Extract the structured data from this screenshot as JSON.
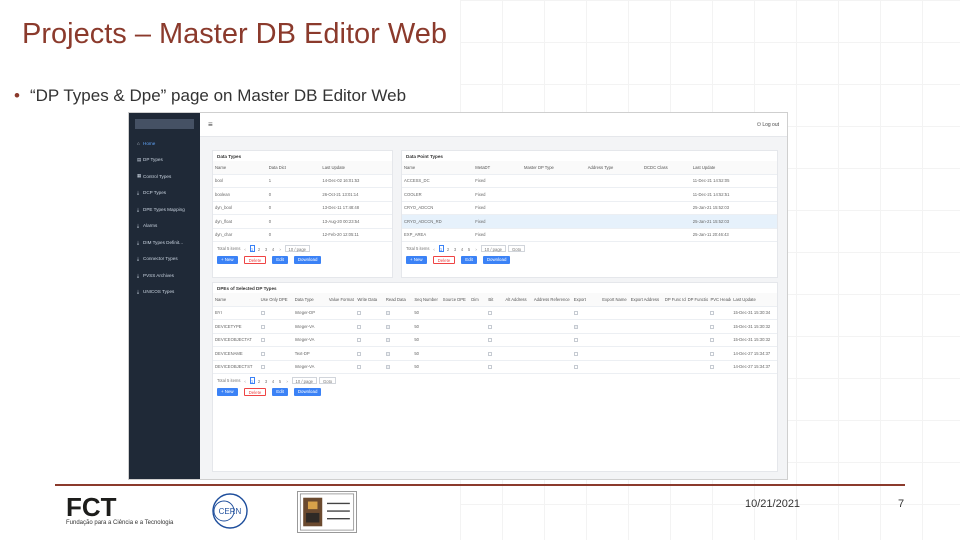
{
  "slide": {
    "title": "Projects – Master DB Editor Web",
    "bullet": "“DP Types & Dpe” page on Master DB Editor Web",
    "date": "10/21/2021",
    "page_number": "7",
    "footer_org": "Fundação para a Ciência e a Tecnologia",
    "accent_color": "#8b3a2c"
  },
  "app": {
    "logout_label": "Log out",
    "sidebar": [
      {
        "label": "Home",
        "icon": "home-icon",
        "active": true
      },
      {
        "label": "DP Types",
        "icon": "list-icon"
      },
      {
        "label": "Control Types",
        "icon": "grid-icon"
      },
      {
        "label": "DCP Types",
        "icon": "download-icon"
      },
      {
        "label": "DPE Types Mapping",
        "icon": "download-icon"
      },
      {
        "label": "Alarms",
        "icon": "download-icon"
      },
      {
        "label": "DIM Types Definit...",
        "icon": "download-icon"
      },
      {
        "label": "Connector Types",
        "icon": "download-icon"
      },
      {
        "label": "PVSS Archives",
        "icon": "download-icon"
      },
      {
        "label": "UNICOS Types",
        "icon": "download-icon"
      }
    ],
    "data_types": {
      "title": "Data Types",
      "headers": [
        "Name",
        "Data Dict",
        "Last Update"
      ],
      "rows": [
        [
          "bool",
          "1",
          "14-Dec-02 16:01:53"
        ],
        [
          "boolean",
          "0",
          "26-Oct-21 13:01:14"
        ],
        [
          "dyn_bool",
          "0",
          "13-Dec-11 17:48:48"
        ],
        [
          "dyn_float",
          "0",
          "13-Aug-20 00:23:54"
        ],
        [
          "dyn_char",
          "0",
          "12-Feb-20 12:05:11"
        ]
      ]
    },
    "data_point_types": {
      "title": "Data Point Types",
      "headers": [
        "Name",
        "MetaDT",
        "Master DP Type",
        "Address Type",
        "DCDC Class",
        "Last Update"
      ],
      "rows": [
        [
          "ACCESS_DC",
          "Fixed",
          "",
          "",
          "",
          "11-Dec-21 14:52:05"
        ],
        [
          "COOLER",
          "Fixed",
          "",
          "",
          "",
          "11-Dec-21 14:52:51"
        ],
        [
          "CRYO_ADCCN",
          "Fixed",
          "",
          "",
          "",
          "25-Jan-21 15:52:03"
        ],
        [
          "CRYO_ADCCN_RD",
          "Fixed",
          "",
          "",
          "",
          "25-Jan-21 15:52:03"
        ],
        [
          "EXP_AREA",
          "Fixed",
          "",
          "",
          "",
          "25-Jan-11 20:46:43"
        ]
      ]
    },
    "dpe_table": {
      "title": "DPEs of Selected DP Types",
      "headers": [
        "Name",
        "Use Only DPE",
        "Data Type",
        "Value Format",
        "Write Data",
        "Read Data",
        "Seq Number",
        "Source DPE",
        "Dim",
        "Bit",
        "Alt Address",
        "Address Reference",
        "Export",
        "Export Name",
        "Export Address",
        "DP Func Idx",
        "DP Function",
        "PVC Header",
        "Last Update"
      ],
      "rows": [
        {
          "name": "BYI",
          "type": "Integer-DP",
          "seq": "50",
          "read": true,
          "export": false,
          "update": [
            "15-Dec-31",
            "15:30:34"
          ]
        },
        {
          "name": "DEVICETYPE",
          "type": "Integer-VA",
          "seq": "50",
          "read": true,
          "export": true,
          "update": [
            "15-Dec-31",
            "15:30:32"
          ]
        },
        {
          "name": "DEVICEOBJECTAT",
          "type": "Integer-VA",
          "seq": "50",
          "read": true,
          "export": false,
          "update": [
            "15-Dec-31",
            "15:30:32"
          ]
        },
        {
          "name": "DEVICENAME",
          "type": "Text-DP",
          "seq": "50",
          "read": true,
          "export": false,
          "update": [
            "14-Dec-27",
            "15:34:37"
          ]
        },
        {
          "name": "DEVICEOBJECTST",
          "type": "Integer-VA",
          "seq": "50",
          "read": true,
          "export": false,
          "update": [
            "14-Dec-27",
            "15:34:37"
          ]
        }
      ]
    },
    "pager": {
      "total": "Total 5 items",
      "pages": [
        "1",
        "2",
        "3",
        "4",
        "5"
      ],
      "page_size": "10 / page",
      "goto": "Goto"
    },
    "buttons": {
      "new": "+ New",
      "delete": "Delete",
      "edit": "Edit",
      "download": "Download"
    }
  }
}
